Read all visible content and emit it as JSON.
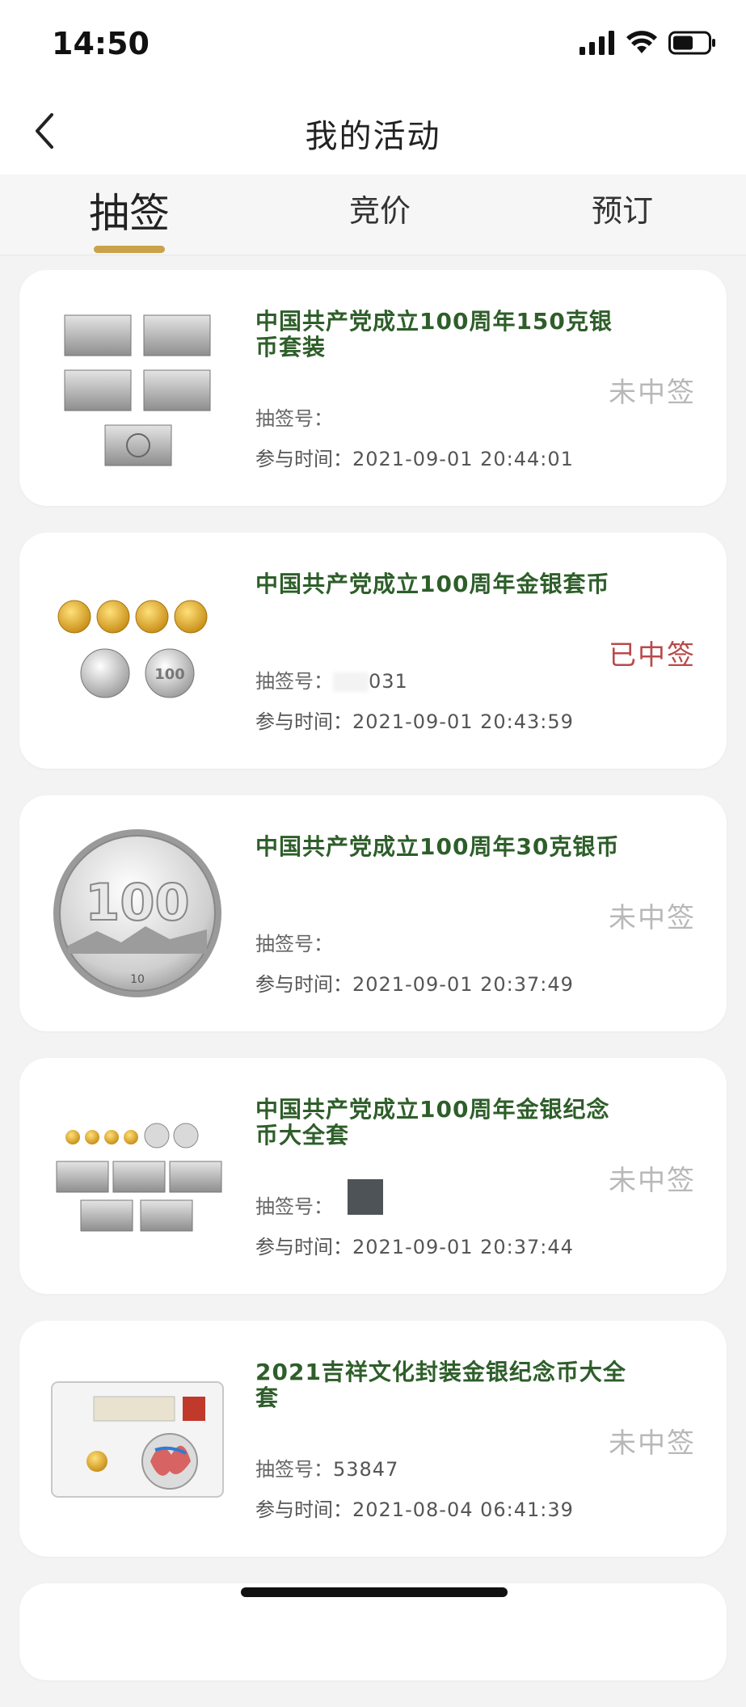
{
  "status": {
    "time": "14:50"
  },
  "nav": {
    "title": "我的活动"
  },
  "tabs": [
    {
      "label": "抽签"
    },
    {
      "label": "竞价"
    },
    {
      "label": "预订"
    }
  ],
  "colors": {
    "accent": "#c9a24a",
    "title_green": "#2e5e2a",
    "won_red": "#b84a4a",
    "not_won_gray": "#b8b8b8"
  },
  "labels": {
    "code": "抽签号：",
    "time": "参与时间："
  },
  "cards": [
    {
      "title": "中国共产党成立100周年150克银币套装",
      "code": "",
      "time": "2021-09-01 20:44:01",
      "status": "未中签",
      "thumb": "rect-silver-set-icon"
    },
    {
      "title": "中国共产党成立100周年金银套币",
      "code": "031",
      "time": "2021-09-01 20:43:59",
      "status": "已中签",
      "thumb": "gold-silver-coins-icon"
    },
    {
      "title": "中国共产党成立100周年30克银币",
      "code": "",
      "time": "2021-09-01 20:37:49",
      "status": "未中签",
      "thumb": "silver-coin-100-icon"
    },
    {
      "title": "中国共产党成立100周年金银纪念币大全套",
      "code": "",
      "time": "2021-09-01 20:37:44",
      "status": "未中签",
      "thumb": "full-set-icon"
    },
    {
      "title": "2021吉祥文化封装金银纪念币大全套",
      "code": "53847",
      "time": "2021-08-04 06:41:39",
      "status": "未中签",
      "thumb": "sealed-coin-set-icon"
    }
  ]
}
